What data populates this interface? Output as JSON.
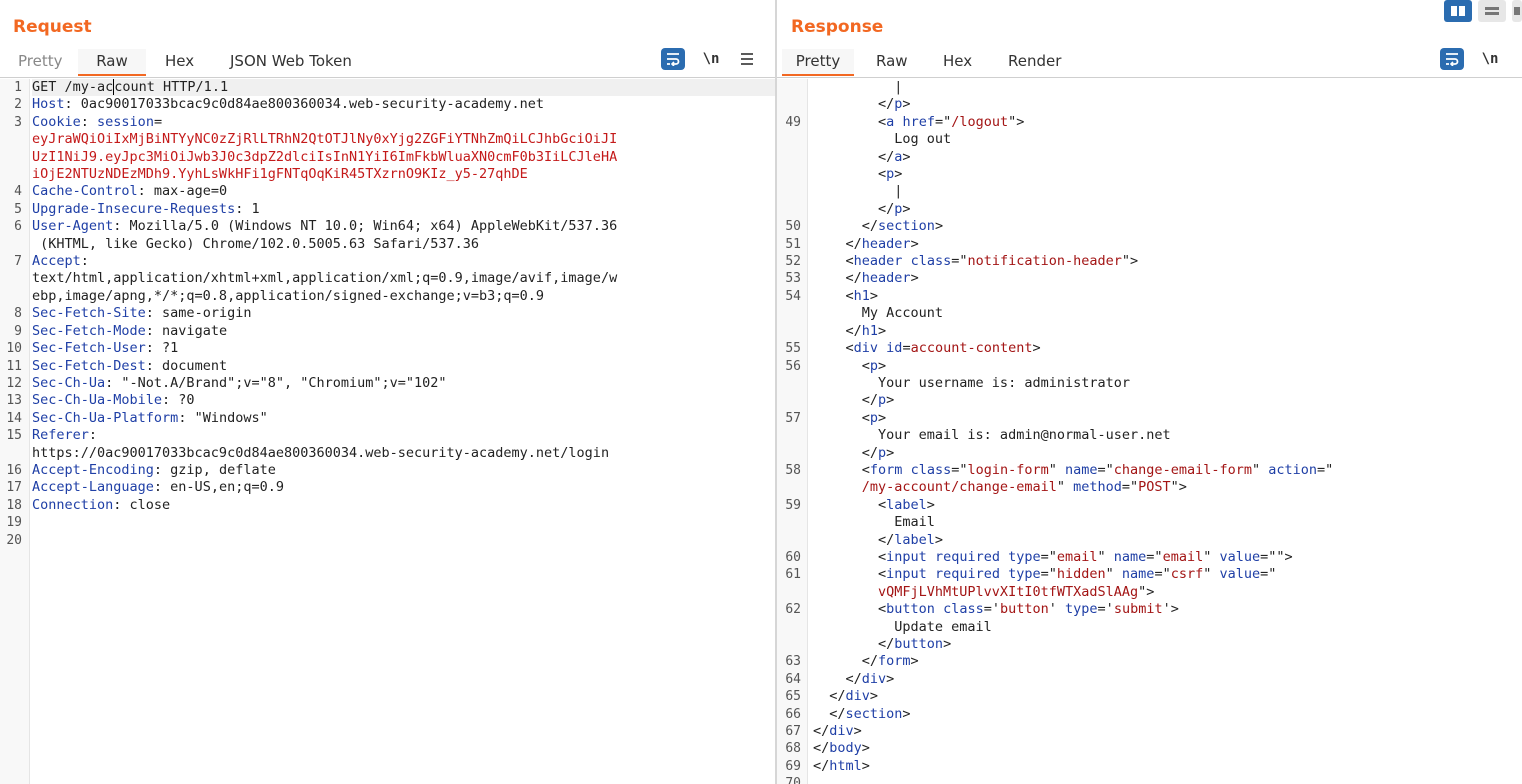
{
  "request": {
    "title": "Request",
    "tabs": [
      "Pretty",
      "Raw",
      "Hex",
      "JSON Web Token"
    ],
    "active_tab": "Raw",
    "lines": [
      {
        "n": "1",
        "parts": [
          [
            "pl",
            "GET /my-ac"
          ],
          [
            "caret",
            "count HTTP/1.1"
          ]
        ]
      },
      {
        "n": "2",
        "parts": [
          [
            "k",
            "Host"
          ],
          [
            "pl",
            ": 0ac90017033bcac9c0d84ae800360034.web-security-academy.net"
          ]
        ]
      },
      {
        "n": "3",
        "parts": [
          [
            "k",
            "Cookie"
          ],
          [
            "pl",
            ": "
          ],
          [
            "k",
            "session"
          ],
          [
            "pl",
            "="
          ]
        ]
      },
      {
        "n": "",
        "parts": [
          [
            "ck",
            "eyJraWQiOiIxMjBiNTYyNC0zZjRlLTRhN2QtOTJlNy0xYjg2ZGFiYTNhZmQiLCJhbGciOiJI"
          ]
        ]
      },
      {
        "n": "",
        "parts": [
          [
            "ck",
            "UzI1NiJ9.eyJpc3MiOiJwb3J0c3dpZ2dlciIsInN1YiI6ImFkbWluaXN0cmF0b3IiLCJleHA"
          ]
        ]
      },
      {
        "n": "",
        "parts": [
          [
            "ck",
            "iOjE2NTUzNDEzMDh9.YyhLsWkHFi1gFNTqOqKiR45TXzrnO9KIz_y5-27qhDE"
          ]
        ]
      },
      {
        "n": "4",
        "parts": [
          [
            "k",
            "Cache-Control"
          ],
          [
            "pl",
            ": max-age=0"
          ]
        ]
      },
      {
        "n": "5",
        "parts": [
          [
            "k",
            "Upgrade-Insecure-Requests"
          ],
          [
            "pl",
            ": 1"
          ]
        ]
      },
      {
        "n": "6",
        "parts": [
          [
            "k",
            "User-Agent"
          ],
          [
            "pl",
            ": Mozilla/5.0 (Windows NT 10.0; Win64; x64) AppleWebKit/537.36"
          ]
        ]
      },
      {
        "n": "",
        "parts": [
          [
            "pl",
            " (KHTML, like Gecko) Chrome/102.0.5005.63 Safari/537.36"
          ]
        ]
      },
      {
        "n": "7",
        "parts": [
          [
            "k",
            "Accept"
          ],
          [
            "pl",
            ":"
          ]
        ]
      },
      {
        "n": "",
        "parts": [
          [
            "pl",
            "text/html,application/xhtml+xml,application/xml;q=0.9,image/avif,image/w"
          ]
        ]
      },
      {
        "n": "",
        "parts": [
          [
            "pl",
            "ebp,image/apng,*/*;q=0.8,application/signed-exchange;v=b3;q=0.9"
          ]
        ]
      },
      {
        "n": "8",
        "parts": [
          [
            "k",
            "Sec-Fetch-Site"
          ],
          [
            "pl",
            ": same-origin"
          ]
        ]
      },
      {
        "n": "9",
        "parts": [
          [
            "k",
            "Sec-Fetch-Mode"
          ],
          [
            "pl",
            ": navigate"
          ]
        ]
      },
      {
        "n": "10",
        "parts": [
          [
            "k",
            "Sec-Fetch-User"
          ],
          [
            "pl",
            ": ?1"
          ]
        ]
      },
      {
        "n": "11",
        "parts": [
          [
            "k",
            "Sec-Fetch-Dest"
          ],
          [
            "pl",
            ": document"
          ]
        ]
      },
      {
        "n": "12",
        "parts": [
          [
            "k",
            "Sec-Ch-Ua"
          ],
          [
            "pl",
            ": \"-Not.A/Brand\";v=\"8\", \"Chromium\";v=\"102\""
          ]
        ]
      },
      {
        "n": "13",
        "parts": [
          [
            "k",
            "Sec-Ch-Ua-Mobile"
          ],
          [
            "pl",
            ": ?0"
          ]
        ]
      },
      {
        "n": "14",
        "parts": [
          [
            "k",
            "Sec-Ch-Ua-Platform"
          ],
          [
            "pl",
            ": \"Windows\""
          ]
        ]
      },
      {
        "n": "15",
        "parts": [
          [
            "k",
            "Referer"
          ],
          [
            "pl",
            ":"
          ]
        ]
      },
      {
        "n": "",
        "parts": [
          [
            "pl",
            "https://0ac90017033bcac9c0d84ae800360034.web-security-academy.net/login"
          ]
        ]
      },
      {
        "n": "16",
        "parts": [
          [
            "k",
            "Accept-Encoding"
          ],
          [
            "pl",
            ": gzip, deflate"
          ]
        ]
      },
      {
        "n": "17",
        "parts": [
          [
            "k",
            "Accept-Language"
          ],
          [
            "pl",
            ": en-US,en;q=0.9"
          ]
        ]
      },
      {
        "n": "18",
        "parts": [
          [
            "k",
            "Connection"
          ],
          [
            "pl",
            ": close"
          ]
        ]
      },
      {
        "n": "19",
        "parts": []
      },
      {
        "n": "20",
        "parts": []
      }
    ]
  },
  "response": {
    "title": "Response",
    "tabs": [
      "Pretty",
      "Raw",
      "Hex",
      "Render"
    ],
    "active_tab": "Pretty",
    "lines": [
      {
        "n": "",
        "parts": [
          [
            "pl",
            "          |"
          ]
        ]
      },
      {
        "n": "",
        "parts": [
          [
            "pl",
            "        </"
          ],
          [
            "tg",
            "p"
          ],
          [
            "pl",
            ">"
          ]
        ]
      },
      {
        "n": "49",
        "parts": [
          [
            "pl",
            "        <"
          ],
          [
            "tg",
            "a"
          ],
          [
            "pl",
            " "
          ],
          [
            "at",
            "href"
          ],
          [
            "pl",
            "=\""
          ],
          [
            "vl",
            "/logout"
          ],
          [
            "pl",
            "\">"
          ]
        ]
      },
      {
        "n": "",
        "parts": [
          [
            "pl",
            "          Log out"
          ]
        ]
      },
      {
        "n": "",
        "parts": [
          [
            "pl",
            "        </"
          ],
          [
            "tg",
            "a"
          ],
          [
            "pl",
            ">"
          ]
        ]
      },
      {
        "n": "",
        "parts": [
          [
            "pl",
            "        <"
          ],
          [
            "tg",
            "p"
          ],
          [
            "pl",
            ">"
          ]
        ]
      },
      {
        "n": "",
        "parts": [
          [
            "pl",
            "          |"
          ]
        ]
      },
      {
        "n": "",
        "parts": [
          [
            "pl",
            "        </"
          ],
          [
            "tg",
            "p"
          ],
          [
            "pl",
            ">"
          ]
        ]
      },
      {
        "n": "50",
        "parts": [
          [
            "pl",
            "      </"
          ],
          [
            "tg",
            "section"
          ],
          [
            "pl",
            ">"
          ]
        ]
      },
      {
        "n": "51",
        "parts": [
          [
            "pl",
            "    </"
          ],
          [
            "tg",
            "header"
          ],
          [
            "pl",
            ">"
          ]
        ]
      },
      {
        "n": "52",
        "parts": [
          [
            "pl",
            "    <"
          ],
          [
            "tg",
            "header"
          ],
          [
            "pl",
            " "
          ],
          [
            "at",
            "class"
          ],
          [
            "pl",
            "=\""
          ],
          [
            "vl",
            "notification-header"
          ],
          [
            "pl",
            "\">"
          ]
        ]
      },
      {
        "n": "53",
        "parts": [
          [
            "pl",
            "    </"
          ],
          [
            "tg",
            "header"
          ],
          [
            "pl",
            ">"
          ]
        ]
      },
      {
        "n": "54",
        "parts": [
          [
            "pl",
            "    <"
          ],
          [
            "tg",
            "h1"
          ],
          [
            "pl",
            ">"
          ]
        ]
      },
      {
        "n": "",
        "parts": [
          [
            "pl",
            "      My Account"
          ]
        ]
      },
      {
        "n": "",
        "parts": [
          [
            "pl",
            "    </"
          ],
          [
            "tg",
            "h1"
          ],
          [
            "pl",
            ">"
          ]
        ]
      },
      {
        "n": "55",
        "parts": [
          [
            "pl",
            "    <"
          ],
          [
            "tg",
            "div"
          ],
          [
            "pl",
            " "
          ],
          [
            "at",
            "id"
          ],
          [
            "pl",
            "="
          ],
          [
            "vl",
            "account-content"
          ],
          [
            "pl",
            ">"
          ]
        ]
      },
      {
        "n": "56",
        "parts": [
          [
            "pl",
            "      <"
          ],
          [
            "tg",
            "p"
          ],
          [
            "pl",
            ">"
          ]
        ]
      },
      {
        "n": "",
        "parts": [
          [
            "pl",
            "        Your username is: administrator"
          ]
        ]
      },
      {
        "n": "",
        "parts": [
          [
            "pl",
            "      </"
          ],
          [
            "tg",
            "p"
          ],
          [
            "pl",
            ">"
          ]
        ]
      },
      {
        "n": "57",
        "parts": [
          [
            "pl",
            "      <"
          ],
          [
            "tg",
            "p"
          ],
          [
            "pl",
            ">"
          ]
        ]
      },
      {
        "n": "",
        "parts": [
          [
            "pl",
            "        Your email is: admin@normal-user.net"
          ]
        ]
      },
      {
        "n": "",
        "parts": [
          [
            "pl",
            "      </"
          ],
          [
            "tg",
            "p"
          ],
          [
            "pl",
            ">"
          ]
        ]
      },
      {
        "n": "58",
        "parts": [
          [
            "pl",
            "      <"
          ],
          [
            "tg",
            "form"
          ],
          [
            "pl",
            " "
          ],
          [
            "at",
            "class"
          ],
          [
            "pl",
            "=\""
          ],
          [
            "vl",
            "login-form"
          ],
          [
            "pl",
            "\" "
          ],
          [
            "at",
            "name"
          ],
          [
            "pl",
            "=\""
          ],
          [
            "vl",
            "change-email-form"
          ],
          [
            "pl",
            "\" "
          ],
          [
            "at",
            "action"
          ],
          [
            "pl",
            "=\""
          ]
        ]
      },
      {
        "n": "",
        "parts": [
          [
            "vl",
            "      /my-account/change-email"
          ],
          [
            "pl",
            "\" "
          ],
          [
            "at",
            "method"
          ],
          [
            "pl",
            "=\""
          ],
          [
            "vl",
            "POST"
          ],
          [
            "pl",
            "\">"
          ]
        ]
      },
      {
        "n": "59",
        "parts": [
          [
            "pl",
            "        <"
          ],
          [
            "tg",
            "label"
          ],
          [
            "pl",
            ">"
          ]
        ]
      },
      {
        "n": "",
        "parts": [
          [
            "pl",
            "          Email"
          ]
        ]
      },
      {
        "n": "",
        "parts": [
          [
            "pl",
            "        </"
          ],
          [
            "tg",
            "label"
          ],
          [
            "pl",
            ">"
          ]
        ]
      },
      {
        "n": "60",
        "parts": [
          [
            "pl",
            "        <"
          ],
          [
            "tg",
            "input"
          ],
          [
            "pl",
            " "
          ],
          [
            "at",
            "required type"
          ],
          [
            "pl",
            "=\""
          ],
          [
            "vl",
            "email"
          ],
          [
            "pl",
            "\" "
          ],
          [
            "at",
            "name"
          ],
          [
            "pl",
            "=\""
          ],
          [
            "vl",
            "email"
          ],
          [
            "pl",
            "\" "
          ],
          [
            "at",
            "value"
          ],
          [
            "pl",
            "=\"\">"
          ]
        ]
      },
      {
        "n": "61",
        "parts": [
          [
            "pl",
            "        <"
          ],
          [
            "tg",
            "input"
          ],
          [
            "pl",
            " "
          ],
          [
            "at",
            "required type"
          ],
          [
            "pl",
            "=\""
          ],
          [
            "vl",
            "hidden"
          ],
          [
            "pl",
            "\" "
          ],
          [
            "at",
            "name"
          ],
          [
            "pl",
            "=\""
          ],
          [
            "vl",
            "csrf"
          ],
          [
            "pl",
            "\" "
          ],
          [
            "at",
            "value"
          ],
          [
            "pl",
            "=\""
          ]
        ]
      },
      {
        "n": "",
        "parts": [
          [
            "vl",
            "        vQMFjLVhMtUPlvvXItI0tfWTXadSlAAg"
          ],
          [
            "pl",
            "\">"
          ]
        ]
      },
      {
        "n": "62",
        "parts": [
          [
            "pl",
            "        <"
          ],
          [
            "tg",
            "button"
          ],
          [
            "pl",
            " "
          ],
          [
            "at",
            "class"
          ],
          [
            "pl",
            "='"
          ],
          [
            "vl",
            "button"
          ],
          [
            "pl",
            "' "
          ],
          [
            "at",
            "type"
          ],
          [
            "pl",
            "='"
          ],
          [
            "vl",
            "submit"
          ],
          [
            "pl",
            "'>"
          ]
        ]
      },
      {
        "n": "",
        "parts": [
          [
            "pl",
            "          Update email"
          ]
        ]
      },
      {
        "n": "",
        "parts": [
          [
            "pl",
            "        </"
          ],
          [
            "tg",
            "button"
          ],
          [
            "pl",
            ">"
          ]
        ]
      },
      {
        "n": "63",
        "parts": [
          [
            "pl",
            "      </"
          ],
          [
            "tg",
            "form"
          ],
          [
            "pl",
            ">"
          ]
        ]
      },
      {
        "n": "64",
        "parts": [
          [
            "pl",
            "    </"
          ],
          [
            "tg",
            "div"
          ],
          [
            "pl",
            ">"
          ]
        ]
      },
      {
        "n": "65",
        "parts": [
          [
            "pl",
            "  </"
          ],
          [
            "tg",
            "div"
          ],
          [
            "pl",
            ">"
          ]
        ]
      },
      {
        "n": "66",
        "parts": [
          [
            "pl",
            "  </"
          ],
          [
            "tg",
            "section"
          ],
          [
            "pl",
            ">"
          ]
        ]
      },
      {
        "n": "67",
        "parts": [
          [
            "pl",
            "</"
          ],
          [
            "tg",
            "div"
          ],
          [
            "pl",
            ">"
          ]
        ]
      },
      {
        "n": "68",
        "parts": [
          [
            "pl",
            "</"
          ],
          [
            "tg",
            "body"
          ],
          [
            "pl",
            ">"
          ]
        ]
      },
      {
        "n": "69",
        "parts": [
          [
            "pl",
            "</"
          ],
          [
            "tg",
            "html"
          ],
          [
            "pl",
            ">"
          ]
        ]
      },
      {
        "n": "70",
        "parts": []
      }
    ]
  },
  "toolbar": {
    "newline_label": "\\n"
  },
  "icons": {
    "wrap": "wrap-lines-icon",
    "menu": "hamburger-menu-icon",
    "layout": [
      "layout-side-by-side-icon",
      "layout-top-bottom-icon",
      "layout-tabs-icon"
    ]
  },
  "colors": {
    "accent": "#f26822",
    "keyword": "#1f3fa6",
    "cookie_value": "#c41a1a",
    "attr_value": "#a31515",
    "button_blue": "#2b6cb0"
  }
}
